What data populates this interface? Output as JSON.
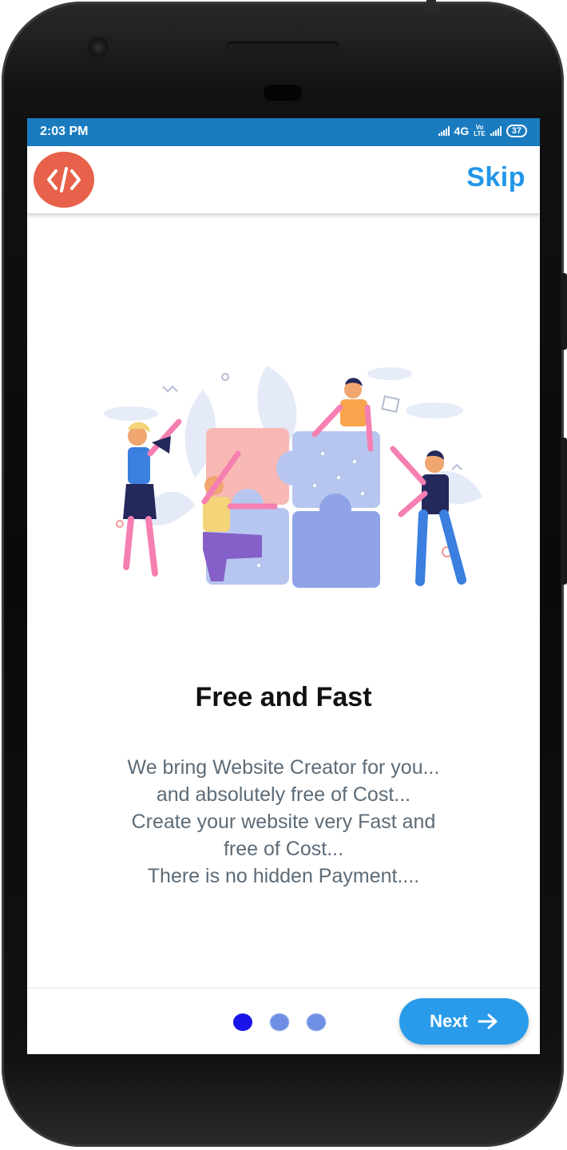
{
  "status_bar": {
    "time": "2:03 PM",
    "network": "4G",
    "volte": "Vo LTE",
    "battery": "37"
  },
  "app_bar": {
    "logo_icon": "code-brackets-icon",
    "skip_label": "Skip"
  },
  "slide": {
    "illustration": "team-puzzle-illustration",
    "title": "Free and Fast",
    "description": [
      "We bring Website Creator for you...",
      "and absolutely free of Cost...",
      "Create your website very Fast and",
      "free of Cost...",
      "There is no hidden Payment...."
    ]
  },
  "pager": {
    "total": 3,
    "active_index": 0
  },
  "next_button": {
    "label": "Next",
    "icon": "arrow-right-icon"
  },
  "colors": {
    "status_bar": "#1a7bbf",
    "accent": "#2196e8",
    "logo_bg": "#e8614a",
    "active_dot": "#1a14e8",
    "inactive_dot": "#6f8fe4"
  }
}
